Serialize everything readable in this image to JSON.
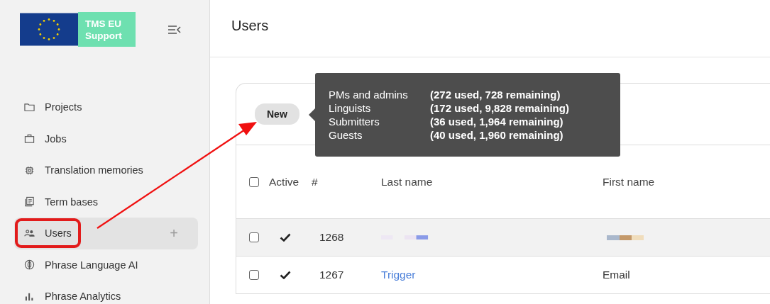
{
  "logo": {
    "text_lines": [
      "TMS EU",
      "Support"
    ]
  },
  "sidebar": {
    "items": [
      {
        "label": "Projects",
        "selected": false
      },
      {
        "label": "Jobs",
        "selected": false
      },
      {
        "label": "Translation memories",
        "selected": false
      },
      {
        "label": "Term bases",
        "selected": false
      },
      {
        "label": "Users",
        "selected": true,
        "highlighted": true,
        "action": "+"
      },
      {
        "label": "Phrase Language AI",
        "selected": false
      },
      {
        "label": "Phrase Analytics",
        "selected": false
      }
    ]
  },
  "page": {
    "title": "Users"
  },
  "new_button": {
    "label": "New"
  },
  "tooltip": {
    "rows": [
      {
        "role": "PMs and admins",
        "usage": "(272 used, 728 remaining)"
      },
      {
        "role": "Linguists",
        "usage": "(172 used, 9,828 remaining)"
      },
      {
        "role": "Submitters",
        "usage": "(36 used, 1,964 remaining)"
      },
      {
        "role": "Guests",
        "usage": "(40 used, 1,960 remaining)"
      }
    ]
  },
  "table": {
    "all_checked": false,
    "columns": [
      "Active",
      "#",
      "Last name",
      "First name"
    ],
    "rows": [
      {
        "checked": false,
        "active": true,
        "id": "1268",
        "redacted": true
      },
      {
        "checked": false,
        "active": true,
        "id": "1267",
        "redacted": false,
        "last_name": "Trigger",
        "first_name": "Email"
      }
    ]
  }
}
